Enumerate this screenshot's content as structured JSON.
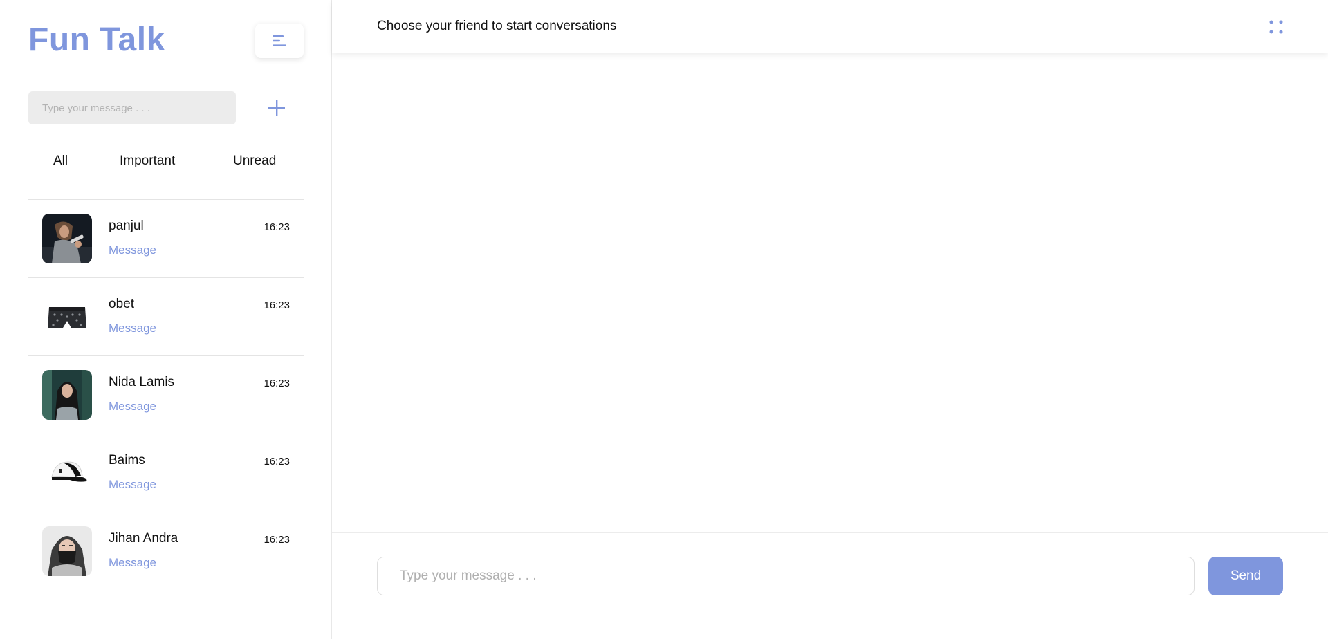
{
  "sidebar": {
    "brand": "Fun Talk",
    "menu_icon": "menu-icon",
    "search": {
      "placeholder": "Type your message . . ."
    },
    "add_icon": "plus-icon",
    "tabs": [
      {
        "label": "All"
      },
      {
        "label": "Important"
      },
      {
        "label": "Unread"
      }
    ],
    "contacts": [
      {
        "name": "panjul",
        "preview": "Message",
        "time": "16:23",
        "avatar": "guitarist-photo"
      },
      {
        "name": "obet",
        "preview": "Message",
        "time": "16:23",
        "avatar": "boxer-shorts-image"
      },
      {
        "name": "Nida Lamis",
        "preview": "Message",
        "time": "16:23",
        "avatar": "woman-hijab-photo"
      },
      {
        "name": "Baims",
        "preview": "Message",
        "time": "16:23",
        "avatar": "baseball-cap-image"
      },
      {
        "name": "Jihan Andra",
        "preview": "Message",
        "time": "16:23",
        "avatar": "veiled-woman-illustration"
      }
    ]
  },
  "chat": {
    "header_title": "Choose your friend to start conversations",
    "options_icon": "four-dots-icon",
    "input": {
      "placeholder": "Type your message . . ."
    },
    "send_label": "Send"
  },
  "colors": {
    "accent": "#7f96dd",
    "search_bg": "#ececec",
    "divider": "#e4e4e4"
  }
}
